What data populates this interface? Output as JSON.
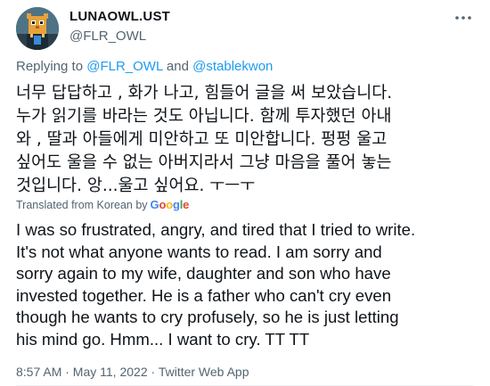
{
  "author": {
    "display_name": "LUNAOWL.UST",
    "handle": "@FLR_OWL"
  },
  "reply": {
    "prefix": "Replying to",
    "mention_1": "@FLR_OWL",
    "connector": "and",
    "mention_2": "@stablekwon"
  },
  "tweet": {
    "original_text": "너무 답답하고 , 화가 나고, 힘들어 글을 써 보았습니다.\n누가 읽기를 바라는 것도 아닙니다.  함께 투자했던 아내\n와 , 딸과 아들에게 미안하고 또 미안합니다.  펑펑 울고\n싶어도 울을 수 없는 아버지라서 그냥 마음을 풀어 놓는\n것입니다.  앙...울고 싶어요.  ㅜㅡㅜ",
    "translated_label": "Translated from Korean by",
    "translation_provider": "Google",
    "translated_text": "I was so frustrated, angry, and tired that I tried to write.\nIt's not what anyone wants to read. I am sorry and\nsorry again to my wife, daughter and son who have\ninvested together. He is a father who can't cry even\nthough he wants to cry profusely, so he is just letting\nhis mind go. Hmm... I want to cry. TT TT"
  },
  "meta": {
    "timestamp": "8:57 AM · May 11, 2022",
    "separator": " · ",
    "source": "Twitter Web App"
  },
  "icons": {
    "more": "more-horizontal-icon",
    "avatar": "owl-avatar"
  },
  "colors": {
    "link": "#1d9bf0",
    "secondary_text": "#536471",
    "primary_text": "#0f1419"
  }
}
